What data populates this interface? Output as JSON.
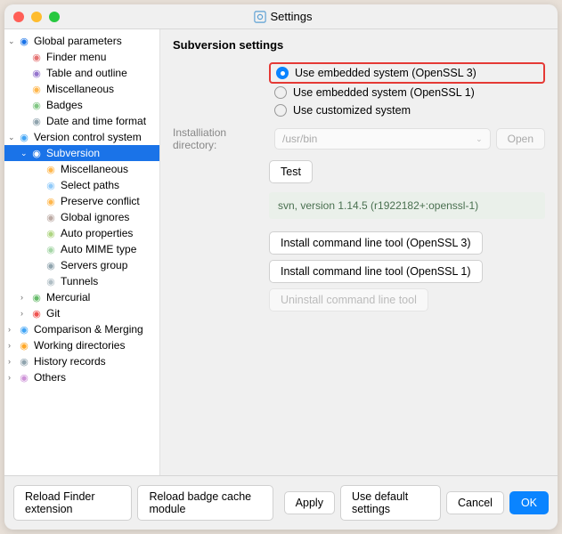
{
  "window": {
    "title": "Settings"
  },
  "sidebar": {
    "items": [
      {
        "label": "Global parameters",
        "level": 0,
        "expanded": true,
        "hasChildren": true,
        "iconColor": "#1a73e8"
      },
      {
        "label": "Finder menu",
        "level": 1,
        "iconColor": "#e57373"
      },
      {
        "label": "Table and outline",
        "level": 1,
        "iconColor": "#9575cd"
      },
      {
        "label": "Miscellaneous",
        "level": 1,
        "iconColor": "#ffb74d"
      },
      {
        "label": "Badges",
        "level": 1,
        "iconColor": "#81c784"
      },
      {
        "label": "Date and time format",
        "level": 1,
        "iconColor": "#90a4ae"
      },
      {
        "label": "Version control system",
        "level": 0,
        "expanded": true,
        "hasChildren": true,
        "iconColor": "#42a5f5"
      },
      {
        "label": "Subversion",
        "level": 1,
        "expanded": true,
        "hasChildren": true,
        "selected": true,
        "iconColor": "#fff"
      },
      {
        "label": "Miscellaneous",
        "level": 2,
        "iconColor": "#ffb74d"
      },
      {
        "label": "Select paths",
        "level": 2,
        "iconColor": "#90caf9"
      },
      {
        "label": "Preserve conflict",
        "level": 2,
        "iconColor": "#ffb74d"
      },
      {
        "label": "Global ignores",
        "level": 2,
        "iconColor": "#bcaaa4"
      },
      {
        "label": "Auto properties",
        "level": 2,
        "iconColor": "#aed581"
      },
      {
        "label": "Auto MIME type",
        "level": 2,
        "iconColor": "#a5d6a7"
      },
      {
        "label": "Servers group",
        "level": 2,
        "iconColor": "#90a4ae"
      },
      {
        "label": "Tunnels",
        "level": 2,
        "iconColor": "#b0bec5"
      },
      {
        "label": "Mercurial",
        "level": 1,
        "hasChildren": true,
        "iconColor": "#66bb6a"
      },
      {
        "label": "Git",
        "level": 1,
        "hasChildren": true,
        "iconColor": "#ef5350"
      },
      {
        "label": "Comparison & Merging",
        "level": 0,
        "hasChildren": true,
        "iconColor": "#42a5f5"
      },
      {
        "label": "Working directories",
        "level": 0,
        "hasChildren": true,
        "iconColor": "#ffa726"
      },
      {
        "label": "History records",
        "level": 0,
        "hasChildren": true,
        "iconColor": "#90a4ae"
      },
      {
        "label": "Others",
        "level": 0,
        "hasChildren": true,
        "iconColor": "#ce93d8"
      }
    ]
  },
  "main": {
    "heading": "Subversion settings",
    "radios": [
      {
        "label": "Use embedded system (OpenSSL 3)",
        "checked": true,
        "highlighted": true
      },
      {
        "label": "Use embedded system (OpenSSL 1)",
        "checked": false
      },
      {
        "label": "Use customized system",
        "checked": false
      }
    ],
    "install_dir_label": "Installiation directory:",
    "install_dir_value": "/usr/bin",
    "open_btn": "Open",
    "test_btn": "Test",
    "version_text": "svn, version 1.14.5 (r1922182+:openssl-1)",
    "install_btn1": "Install command line tool (OpenSSL 3)",
    "install_btn2": "Install command line tool (OpenSSL 1)",
    "uninstall_btn": "Uninstall command line tool"
  },
  "footer": {
    "reload_finder": "Reload Finder extension",
    "reload_badge": "Reload badge cache module",
    "apply": "Apply",
    "defaults": "Use default settings",
    "cancel": "Cancel",
    "ok": "OK"
  }
}
